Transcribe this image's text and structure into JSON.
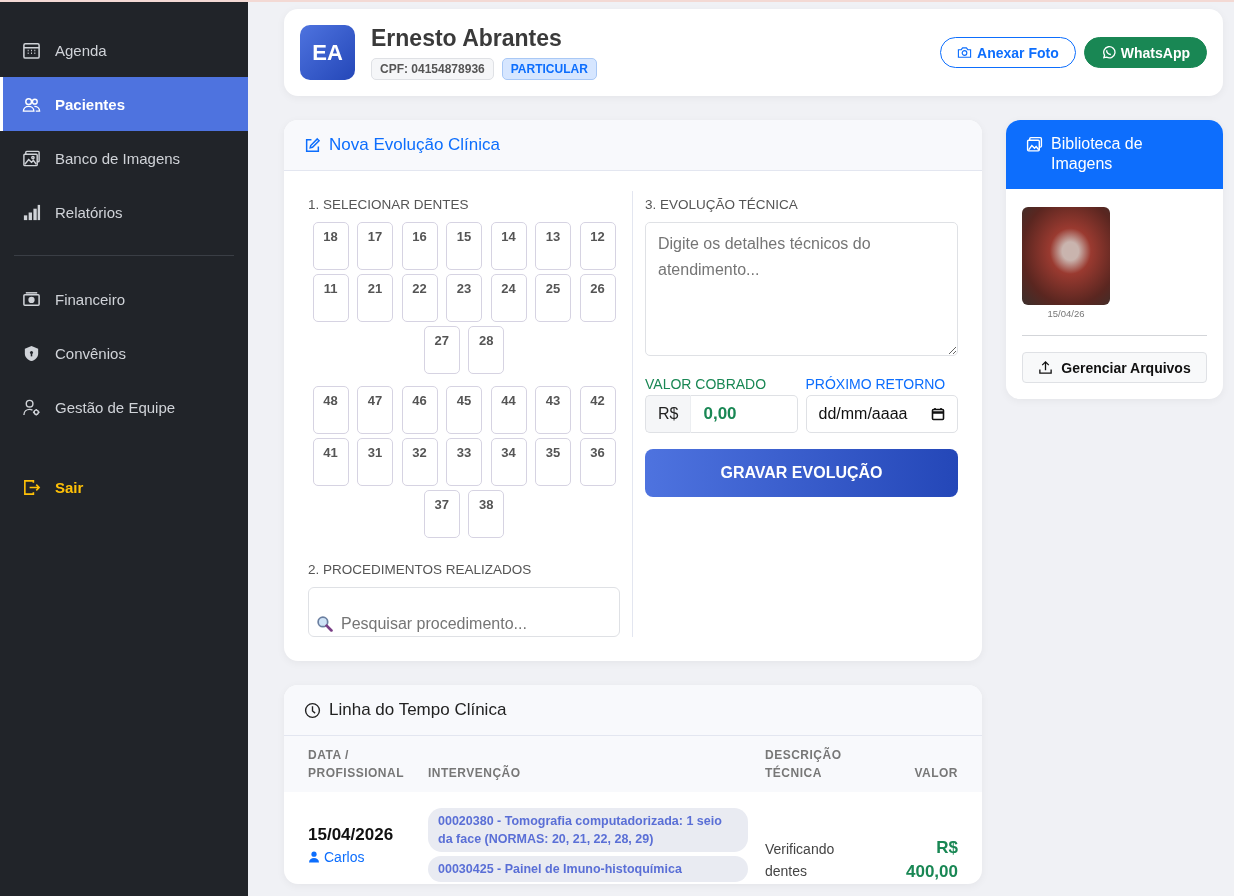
{
  "sidebar": {
    "groups": [
      {
        "items": [
          {
            "label": "Agenda",
            "kind": "calendar",
            "selected": false
          },
          {
            "label": "Pacientes",
            "kind": "users",
            "selected": true
          },
          {
            "label": "Banco de Imagens",
            "kind": "images",
            "selected": false
          },
          {
            "label": "Relatórios",
            "kind": "chart",
            "selected": false
          }
        ]
      },
      {
        "items": [
          {
            "label": "Financeiro",
            "kind": "cash",
            "selected": false
          },
          {
            "label": "Convênios",
            "kind": "shield",
            "selected": false
          },
          {
            "label": "Gestão de Equipe",
            "kind": "team",
            "selected": false
          }
        ]
      },
      {
        "items": [
          {
            "label": "Sair",
            "kind": "logout",
            "selected": false
          }
        ]
      }
    ]
  },
  "patient": {
    "initials": "EA",
    "name": "Ernesto Abrantes",
    "cpf": "CPF: 04154878936",
    "plan": "PARTICULAR",
    "buttons": [
      {
        "label": "Anexar Foto",
        "kind": "outline"
      },
      {
        "label": "WhatsApp",
        "kind": "whatsapp"
      }
    ]
  },
  "evolution": {
    "title": "Nova Evolução Clínica",
    "teeth_label": "1. SELECIONAR DENTES",
    "tooth_groups": [
      {
        "rows": [
          [
            {
              "number": "18",
              "selected": false
            },
            {
              "number": "17",
              "selected": false
            },
            {
              "number": "16",
              "selected": false
            },
            {
              "number": "15",
              "selected": false
            },
            {
              "number": "14",
              "selected": false
            },
            {
              "number": "13",
              "selected": false
            },
            {
              "number": "12",
              "selected": false
            }
          ],
          [
            {
              "number": "11",
              "selected": false
            },
            {
              "number": "21",
              "selected": false
            },
            {
              "number": "22",
              "selected": false
            },
            {
              "number": "23",
              "selected": false
            },
            {
              "number": "24",
              "selected": false
            },
            {
              "number": "25",
              "selected": false
            },
            {
              "number": "26",
              "selected": false
            }
          ],
          [
            {
              "number": "27",
              "selected": false
            },
            {
              "number": "28",
              "selected": false
            }
          ]
        ]
      },
      {
        "rows": [
          [
            {
              "number": "48",
              "selected": false
            },
            {
              "number": "47",
              "selected": false
            },
            {
              "number": "46",
              "selected": false
            },
            {
              "number": "45",
              "selected": false
            },
            {
              "number": "44",
              "selected": false
            },
            {
              "number": "43",
              "selected": false
            },
            {
              "number": "42",
              "selected": false
            }
          ],
          [
            {
              "number": "41",
              "selected": false
            },
            {
              "number": "31",
              "selected": false
            },
            {
              "number": "32",
              "selected": false
            },
            {
              "number": "33",
              "selected": false
            },
            {
              "number": "34",
              "selected": false
            },
            {
              "number": "35",
              "selected": false
            },
            {
              "number": "36",
              "selected": false
            }
          ],
          [
            {
              "number": "37",
              "selected": false
            },
            {
              "number": "38",
              "selected": false
            }
          ]
        ]
      }
    ],
    "procedures_label": "2. PROCEDIMENTOS REALIZADOS",
    "procedures_search": {
      "placeholder": "Pesquisar procedimento..."
    },
    "technical_label": "3. EVOLUÇÃO TÉCNICA",
    "technical_field": {
      "placeholder": "Digite os detalhes técnicos do atendimento..."
    },
    "value_label": "VALOR COBRADO",
    "currency": "R$",
    "value": "0,00",
    "return_label": "PRÓXIMO RETORNO",
    "return_field": {
      "placeholder": "dd/mm/aaaa"
    },
    "save_button": "GRAVAR EVOLUÇÃO"
  },
  "library": {
    "title": "Biblioteca de Imagens",
    "images": [
      {
        "date": "15/04/26"
      }
    ],
    "manage_button": "Gerenciar Arquivos"
  },
  "timeline": {
    "title": "Linha do Tempo Clínica",
    "columns": [
      "DATA / PROFISSIONAL",
      "INTERVENÇÃO",
      "DESCRIÇÃO TÉCNICA",
      "VALOR"
    ],
    "rows": [
      {
        "date": "15/04/2026",
        "professional": "Carlos",
        "procedures": [
          "00020380 - Tomografia computadorizada: 1 seio da face (NORMAS: 20, 21, 22, 28, 29)",
          "00030425 - Painel de Imuno-histoquímica"
        ],
        "description": "Verificando dentes",
        "value": "R$ 400,00"
      }
    ]
  }
}
